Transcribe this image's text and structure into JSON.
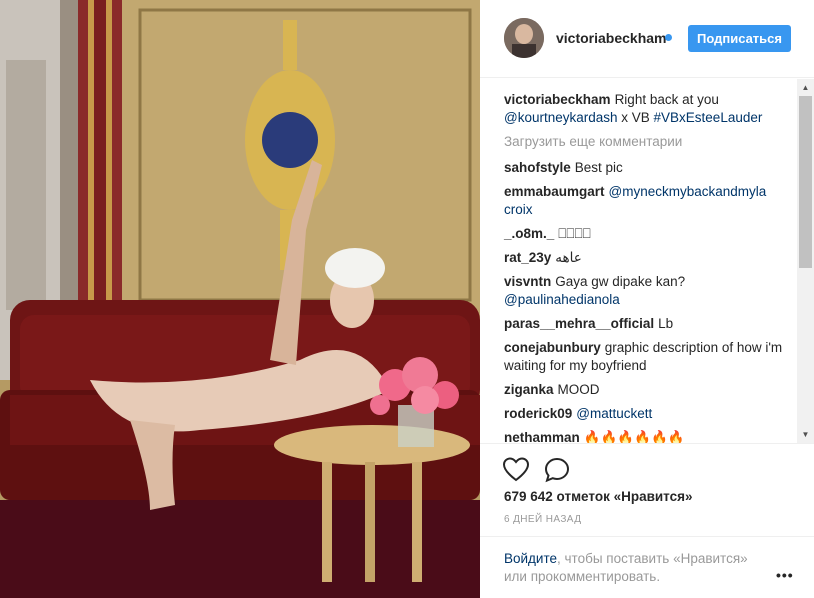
{
  "post": {
    "author": "victoriabeckham",
    "follow_label": "Подписаться",
    "caption": {
      "author": "victoriabeckham",
      "text": "Right back at you",
      "mention1": "@kourtneykardash",
      "middle": " x VB ",
      "hashtag": "#VBxEsteeLauder"
    },
    "load_more": "Загрузить еще комментарии",
    "comments": [
      {
        "author": "sahofstyle",
        "text": "Best pic"
      },
      {
        "author": "emmabaumgart",
        "mention": "@myneckmybackandmyla croix"
      },
      {
        "author": "_.o8m._",
        "text": "⎕⎕⎕⎕"
      },
      {
        "author": "rat_23y",
        "text": "عاهه"
      },
      {
        "author": "visvntn",
        "text": "Gaya gw dipake kan?",
        "mention": "@paulinahedianola"
      },
      {
        "author": "paras__mehra__official",
        "text": "Lb"
      },
      {
        "author": "conejabunbury",
        "text": "graphic description of how i'm waiting for my boyfriend"
      },
      {
        "author": "ziganka",
        "text": "MOOD"
      },
      {
        "author": "roderick09",
        "mention": "@mattuckett"
      },
      {
        "author": "nethamman",
        "text": "🔥🔥🔥🔥🔥🔥"
      }
    ],
    "likes": "679 642 отметок «Нравится»",
    "timestamp": "6 ДНЕЙ НАЗАД",
    "login_link": "Войдите",
    "login_rest": ", чтобы поставить «Нравится» или прокомментировать.",
    "more_label": "•••"
  },
  "icons": {
    "like": "heart-icon",
    "comment": "comment-bubble-icon",
    "scroll_up": "▲",
    "scroll_down": "▼"
  },
  "colors": {
    "accent": "#3897f0",
    "link": "#003569",
    "muted": "#999999"
  }
}
